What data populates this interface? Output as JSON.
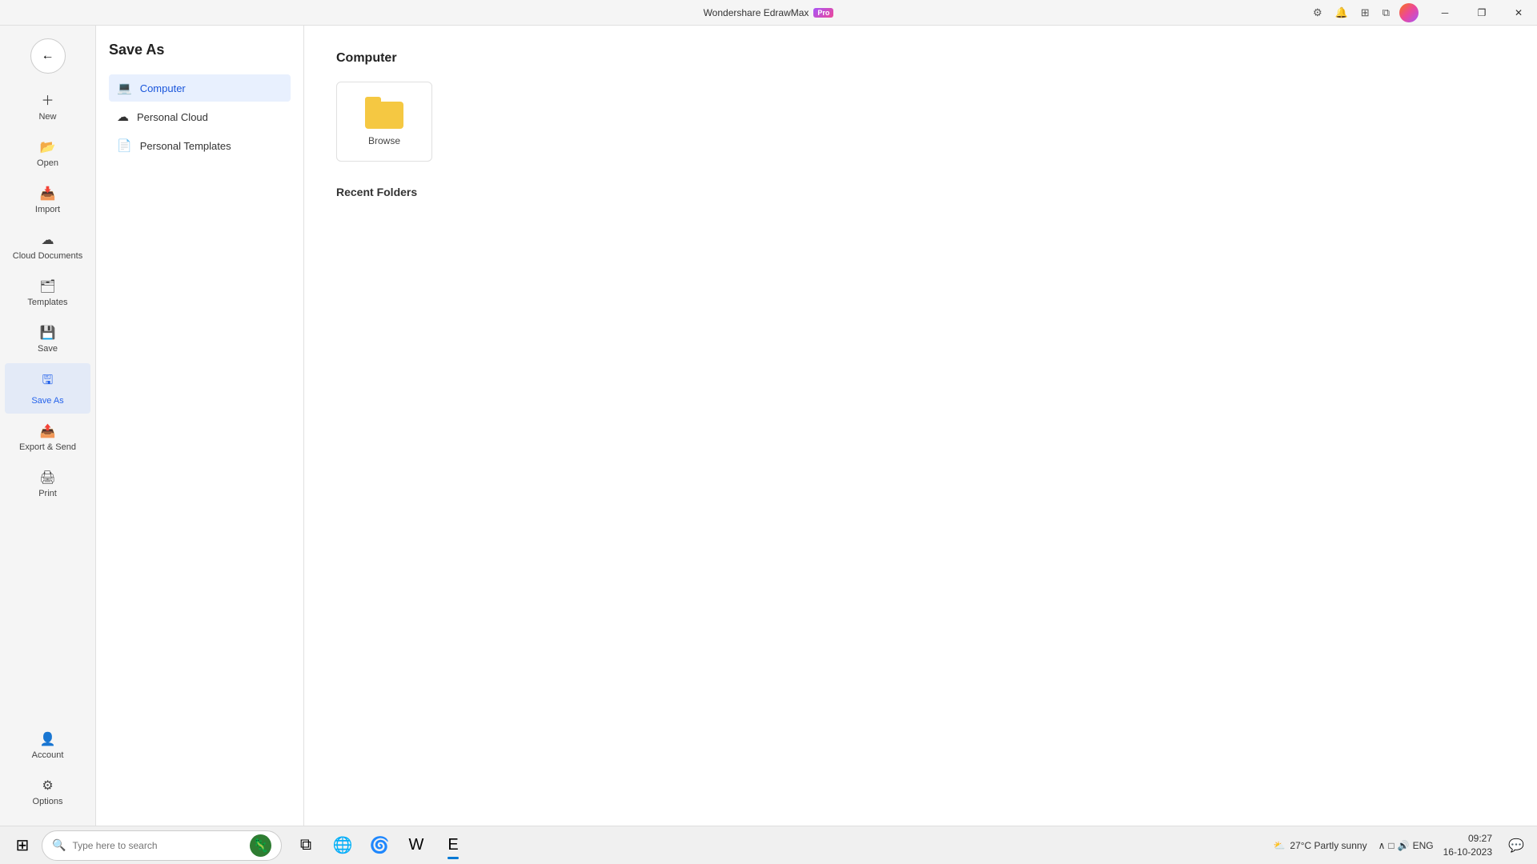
{
  "titlebar": {
    "app_name": "Wondershare EdrawMax",
    "pro_label": "Pro",
    "minimize_label": "─",
    "restore_label": "❐",
    "close_label": "✕"
  },
  "titlebar_actions": {
    "settings_icon": "⚙",
    "bell_icon": "🔔",
    "grid_icon": "⊞",
    "layers_icon": "⧉"
  },
  "sidebar": {
    "back_icon": "←",
    "items": [
      {
        "id": "new",
        "label": "New",
        "icon": "＋"
      },
      {
        "id": "open",
        "label": "Open",
        "icon": "📂"
      },
      {
        "id": "import",
        "label": "Import",
        "icon": "📥"
      },
      {
        "id": "cloud",
        "label": "Cloud Documents",
        "icon": "☁"
      },
      {
        "id": "templates",
        "label": "Templates",
        "icon": "🗂"
      },
      {
        "id": "save",
        "label": "Save",
        "icon": "💾"
      },
      {
        "id": "saveas",
        "label": "Save As",
        "icon": "🖫",
        "active": true
      },
      {
        "id": "export",
        "label": "Export & Send",
        "icon": "📤"
      },
      {
        "id": "print",
        "label": "Print",
        "icon": "🖨"
      }
    ],
    "bottom_items": [
      {
        "id": "account",
        "label": "Account",
        "icon": "👤"
      },
      {
        "id": "options",
        "label": "Options",
        "icon": "⚙"
      }
    ]
  },
  "saveas_panel": {
    "title": "Save As",
    "options": [
      {
        "id": "computer",
        "label": "Computer",
        "icon": "💻",
        "active": true
      },
      {
        "id": "personal_cloud",
        "label": "Personal Cloud",
        "icon": "☁"
      },
      {
        "id": "personal_templates",
        "label": "Personal Templates",
        "icon": "📄"
      }
    ]
  },
  "main": {
    "section_title": "Computer",
    "browse_label": "Browse",
    "recent_folders_title": "Recent Folders"
  },
  "taskbar": {
    "start_icon": "⊞",
    "search_placeholder": "Type here to search",
    "apps": [
      {
        "id": "taskview",
        "icon": "⧉"
      },
      {
        "id": "chrome",
        "icon": "🌐"
      },
      {
        "id": "edge",
        "icon": "🌀"
      },
      {
        "id": "word",
        "icon": "W"
      },
      {
        "id": "edraw",
        "icon": "E",
        "active": true
      }
    ],
    "weather_icon": "⛅",
    "weather_temp": "27°C  Partly sunny",
    "sys_icons": [
      "∧",
      "□",
      "🔊",
      "ENG"
    ],
    "clock_time": "09:27",
    "clock_date": "16-10-2023",
    "notification_icon": "💬"
  }
}
